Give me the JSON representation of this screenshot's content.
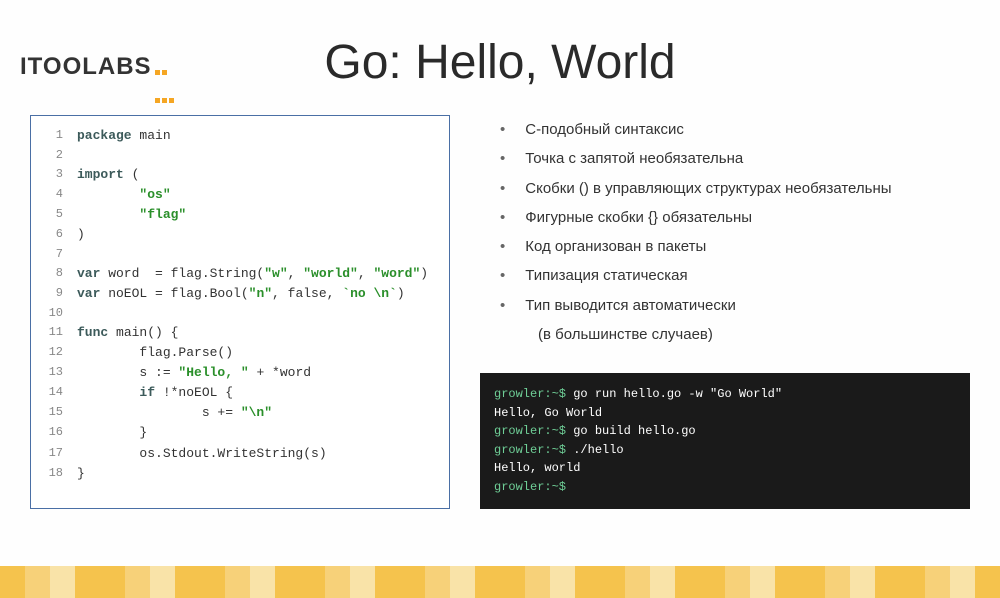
{
  "logo": "ITOOLABS",
  "title": "Go: Hello, World",
  "code": [
    {
      "n": 1,
      "tokens": [
        {
          "cls": "kw",
          "t": "package"
        },
        {
          "cls": "",
          "t": " main"
        }
      ]
    },
    {
      "n": 2,
      "tokens": []
    },
    {
      "n": 3,
      "tokens": [
        {
          "cls": "kw",
          "t": "import"
        },
        {
          "cls": "",
          "t": " ("
        }
      ]
    },
    {
      "n": 4,
      "tokens": [
        {
          "cls": "",
          "t": "        "
        },
        {
          "cls": "str",
          "t": "\"os\""
        }
      ]
    },
    {
      "n": 5,
      "tokens": [
        {
          "cls": "",
          "t": "        "
        },
        {
          "cls": "str",
          "t": "\"flag\""
        }
      ]
    },
    {
      "n": 6,
      "tokens": [
        {
          "cls": "",
          "t": ")"
        }
      ]
    },
    {
      "n": 7,
      "tokens": []
    },
    {
      "n": 8,
      "tokens": [
        {
          "cls": "kw",
          "t": "var"
        },
        {
          "cls": "",
          "t": " word  = flag.String("
        },
        {
          "cls": "str",
          "t": "\"w\""
        },
        {
          "cls": "",
          "t": ", "
        },
        {
          "cls": "str",
          "t": "\"world\""
        },
        {
          "cls": "",
          "t": ", "
        },
        {
          "cls": "str",
          "t": "\"word\""
        },
        {
          "cls": "",
          "t": ")"
        }
      ]
    },
    {
      "n": 9,
      "tokens": [
        {
          "cls": "kw",
          "t": "var"
        },
        {
          "cls": "",
          "t": " noEOL = flag.Bool("
        },
        {
          "cls": "str",
          "t": "\"n\""
        },
        {
          "cls": "",
          "t": ", false, "
        },
        {
          "cls": "str",
          "t": "`no \\n`"
        },
        {
          "cls": "",
          "t": ")"
        }
      ]
    },
    {
      "n": 10,
      "tokens": []
    },
    {
      "n": 11,
      "tokens": [
        {
          "cls": "kw",
          "t": "func"
        },
        {
          "cls": "",
          "t": " main() {"
        }
      ]
    },
    {
      "n": 12,
      "tokens": [
        {
          "cls": "",
          "t": "        flag.Parse()"
        }
      ]
    },
    {
      "n": 13,
      "tokens": [
        {
          "cls": "",
          "t": "        s := "
        },
        {
          "cls": "str",
          "t": "\"Hello, \""
        },
        {
          "cls": "",
          "t": " + *word"
        }
      ]
    },
    {
      "n": 14,
      "tokens": [
        {
          "cls": "",
          "t": "        "
        },
        {
          "cls": "kw",
          "t": "if"
        },
        {
          "cls": "",
          "t": " !*noEOL {"
        }
      ]
    },
    {
      "n": 15,
      "tokens": [
        {
          "cls": "",
          "t": "                s += "
        },
        {
          "cls": "str",
          "t": "\"\\n\""
        }
      ]
    },
    {
      "n": 16,
      "tokens": [
        {
          "cls": "",
          "t": "        }"
        }
      ]
    },
    {
      "n": 17,
      "tokens": [
        {
          "cls": "",
          "t": "        os.Stdout.WriteString(s)"
        }
      ]
    },
    {
      "n": 18,
      "tokens": [
        {
          "cls": "",
          "t": "}"
        }
      ]
    }
  ],
  "bullets": [
    "С-подобный синтаксис",
    "Точка с запятой необязательна",
    "Скобки () в управляющих структурах необязательны",
    "Фигурные скобки {} обязательны",
    "Код организован в пакеты",
    "Типизация статическая",
    "Тип выводится автоматически"
  ],
  "bullet_sub": "(в большинстве случаев)",
  "terminal": [
    {
      "p": "growler:~$",
      "c": " go run hello.go -w \"Go World\""
    },
    {
      "p": "",
      "c": "Hello, Go World"
    },
    {
      "p": "growler:~$",
      "c": " go build hello.go"
    },
    {
      "p": "growler:~$",
      "c": " ./hello"
    },
    {
      "p": "",
      "c": "Hello, world"
    },
    {
      "p": "growler:~$",
      "c": ""
    }
  ]
}
